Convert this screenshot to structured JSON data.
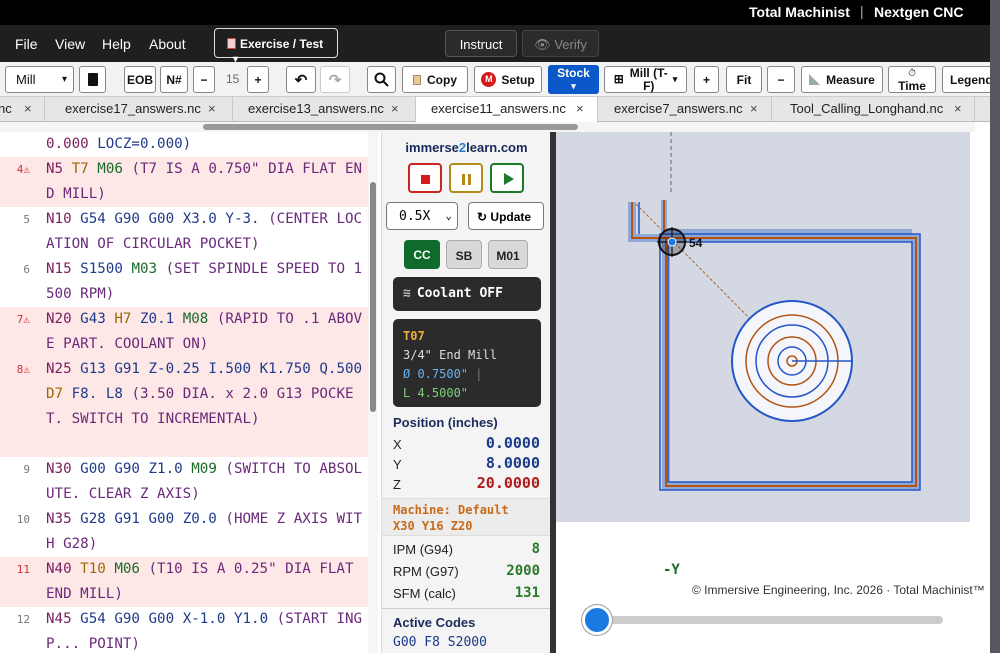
{
  "titlebar": {
    "left": "Total Machinist",
    "separator": "|",
    "right": "Nextgen CNC"
  },
  "menu": {
    "file": "File",
    "view": "View",
    "help": "Help",
    "about": "About",
    "exercise_button": "Exercise / Test",
    "instruct": "Instruct",
    "verify": "Verify"
  },
  "toolbar": {
    "machine_select": "Mill",
    "eob": "EOB",
    "n_number": "N#",
    "minus": "−",
    "count": "15",
    "plus": "+",
    "copy": "Copy",
    "setup": "Setup",
    "stock": "Stock",
    "stock_caret": "▾",
    "mill_view": "Mill (T-F)",
    "zoom_in": "+",
    "fit": "Fit",
    "zoom_out": "−",
    "measure": "Measure",
    "time": "Time",
    "legend": "Legend"
  },
  "tabs": [
    {
      "label": "nc",
      "close": "×"
    },
    {
      "label": "exercise17_answers.nc",
      "close": "×"
    },
    {
      "label": "exercise13_answers.nc",
      "close": "×"
    },
    {
      "label": "exercise11_answers.nc",
      "close": "×"
    },
    {
      "label": "exercise7_answers.nc",
      "close": "×"
    },
    {
      "label": "Tool_Calling_Longhand.nc",
      "close": "×"
    }
  ],
  "code_lines": [
    {
      "num": "",
      "warn": false,
      "text": "0.000 LOCZ=0.000)"
    },
    {
      "num": "4⚠",
      "warn": true,
      "text": "N5 T7 M06 (T7 IS A 0.750\" DIA FLAT END MILL)"
    },
    {
      "num": "5",
      "warn": false,
      "text": "N10 G54 G90 G00 X3.0 Y-3. (CENTER LOCATION OF CIRCULAR POCKET)"
    },
    {
      "num": "6",
      "warn": false,
      "text": "N15 S1500 M03 (SET SPINDLE SPEED TO 1500 RPM)"
    },
    {
      "num": "7⚠",
      "warn": true,
      "text": "N20 G43 H7 Z0.1 M08 (RAPID TO .1 ABOVE PART. COOLANT ON)"
    },
    {
      "num": "8⚠",
      "warn": true,
      "text": "N25 G13 G91 Z-0.25 I.500 K1.750 Q.500 D7 F8. L8 (3.50 DIA. x 2.0 G13 POCKET. SWITCH TO INCREMENTAL)"
    },
    {
      "num": "9",
      "warn": false,
      "text": "N30 G00 G90 Z1.0 M09 (SWITCH TO ABSOLUTE. CLEAR Z AXIS)"
    },
    {
      "num": "10",
      "warn": false,
      "text": "N35 G28 G91 G00 Z0.0 (HOME Z AXIS WITH G28)"
    },
    {
      "num": "11",
      "warn": true,
      "text": "N40 T10 M06 (T10 IS A 0.25\" DIA FLAT END MILL)"
    },
    {
      "num": "12",
      "warn": false,
      "text": "N45 G54 G90 G00 X-1.0 Y1.0 (START ING P... POINT)"
    }
  ],
  "panel": {
    "brand_a": "immerse",
    "brand_b": "2",
    "brand_c": "learn.com",
    "speed": "0.5X",
    "update": "Update",
    "cc": "CC",
    "sb": "SB",
    "m01": "M01",
    "coolant": "Coolant OFF",
    "tool_id": "T07",
    "tool_name": "3/4\" End Mill",
    "tool_dia": "Ø 0.7500\"",
    "tool_len": "L 4.5000\"",
    "position_header": "Position (inches)",
    "x_label": "X",
    "x_value": "0.0000",
    "y_label": "Y",
    "y_value": "8.0000",
    "z_label": "Z",
    "z_value": "20.0000",
    "machine_line1": "Machine: Default",
    "machine_line2": "X30 Y16 Z20",
    "ipm_label": "IPM (G94)",
    "ipm_value": "8",
    "rpm_label": "RPM (G97)",
    "rpm_value": "2000",
    "sfm_label": "SFM (calc)",
    "sfm_value": "131",
    "active_header": "Active Codes",
    "active_value": "G00 F8 S2000"
  },
  "viewport": {
    "marker_label": "54",
    "axis_label": "-Y",
    "copyright": "© Immersive Engineering, Inc. 2026 · Total Machinist™",
    "playback_progress": 0
  },
  "colors": {
    "accent_blue": "#0a58ca",
    "error_bg": "#fde7e7",
    "cc_green": "#0f6b2c",
    "toolpath_orange": "#b5530f",
    "toolpath_blue": "#2456c7"
  }
}
